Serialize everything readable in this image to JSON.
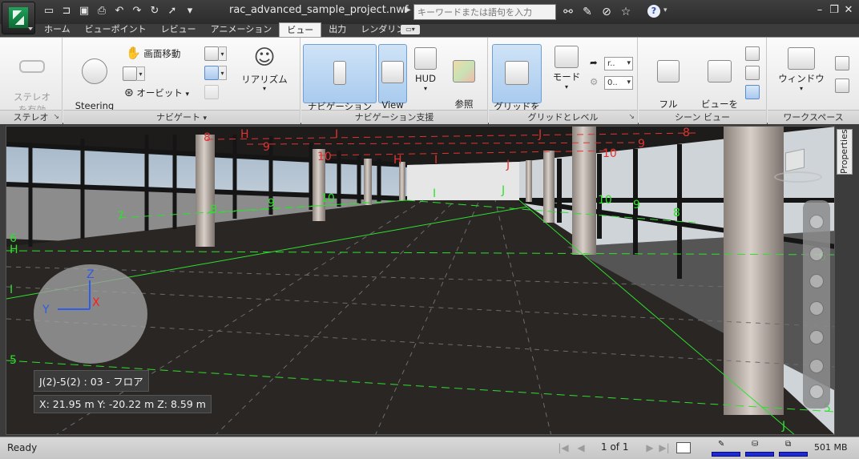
{
  "titlebar": {
    "file_title": "rac_advanced_sample_project.nwf",
    "search_placeholder": "キーワードまたは語句を入力",
    "qat_icons": [
      "new-icon",
      "open-icon",
      "save-icon",
      "print-icon",
      "undo-icon",
      "redo-icon",
      "refresh-icon",
      "select-icon"
    ],
    "title_icons": [
      "binoculars-icon",
      "wrench-icon",
      "no-signal-icon",
      "star-icon"
    ],
    "help_icon": "?"
  },
  "tabs": [
    {
      "label": "ホーム"
    },
    {
      "label": "ビューポイント"
    },
    {
      "label": "レビュー"
    },
    {
      "label": "アニメーション"
    },
    {
      "label": "ビュー",
      "active": true
    },
    {
      "label": "出力"
    },
    {
      "label": "レンダリング"
    }
  ],
  "ribbon": {
    "stereo": {
      "panel": "ステレオ",
      "button": "ステレオ\nを有効"
    },
    "navigate": {
      "panel": "ナビゲート",
      "steering_wheels": "Steering\nWheels",
      "pan": "画面移動",
      "orbit": "オービット",
      "realism": "リアリズム"
    },
    "nav_aids": {
      "panel": "ナビゲーション支援",
      "nav_bar": "ナビゲーション\nバー",
      "view_cube": "View\nCube",
      "hud": "HUD",
      "reference_views": "参照\nビュー"
    },
    "grids": {
      "panel": "グリッドとレベル",
      "show_grid": "グリッドを\n表示",
      "mode": "モード",
      "combo1": "r..",
      "combo2": "0.."
    },
    "scene_view": {
      "panel": "シーン ビュー",
      "full_screen": "フル\nスクリーン",
      "split_view": "ビューを\n分割"
    },
    "workspace": {
      "panel": "ワークスペース",
      "windows": "ウィンドウ"
    }
  },
  "viewport": {
    "grid_labels_red": [
      "8",
      "H",
      "9",
      "I",
      "10",
      "H",
      "I",
      "J",
      "J",
      "10",
      "9",
      "8"
    ],
    "grid_labels_green": [
      "7",
      "8",
      "9",
      "10",
      "I",
      "J",
      "10",
      "9",
      "8",
      "6",
      "H",
      "I",
      "5",
      "5",
      "J",
      "6"
    ],
    "axes": {
      "z": "Z",
      "y": "Y",
      "x": "X"
    },
    "grid_location": "J(2)-5(2) : 03 - フロア",
    "coordinates": "X: 21.95 m  Y: -20.22 m  Z: 8.59 m"
  },
  "properties_tab": "Properties",
  "statusbar": {
    "status": "Ready",
    "page": "1 of 1",
    "memory": "501 MB"
  },
  "colors": {
    "grid_green": "#2ee02e",
    "grid_red": "#e23333",
    "accent_pressed": "#a9cbee",
    "meter_blue": "#1d2ad8"
  }
}
